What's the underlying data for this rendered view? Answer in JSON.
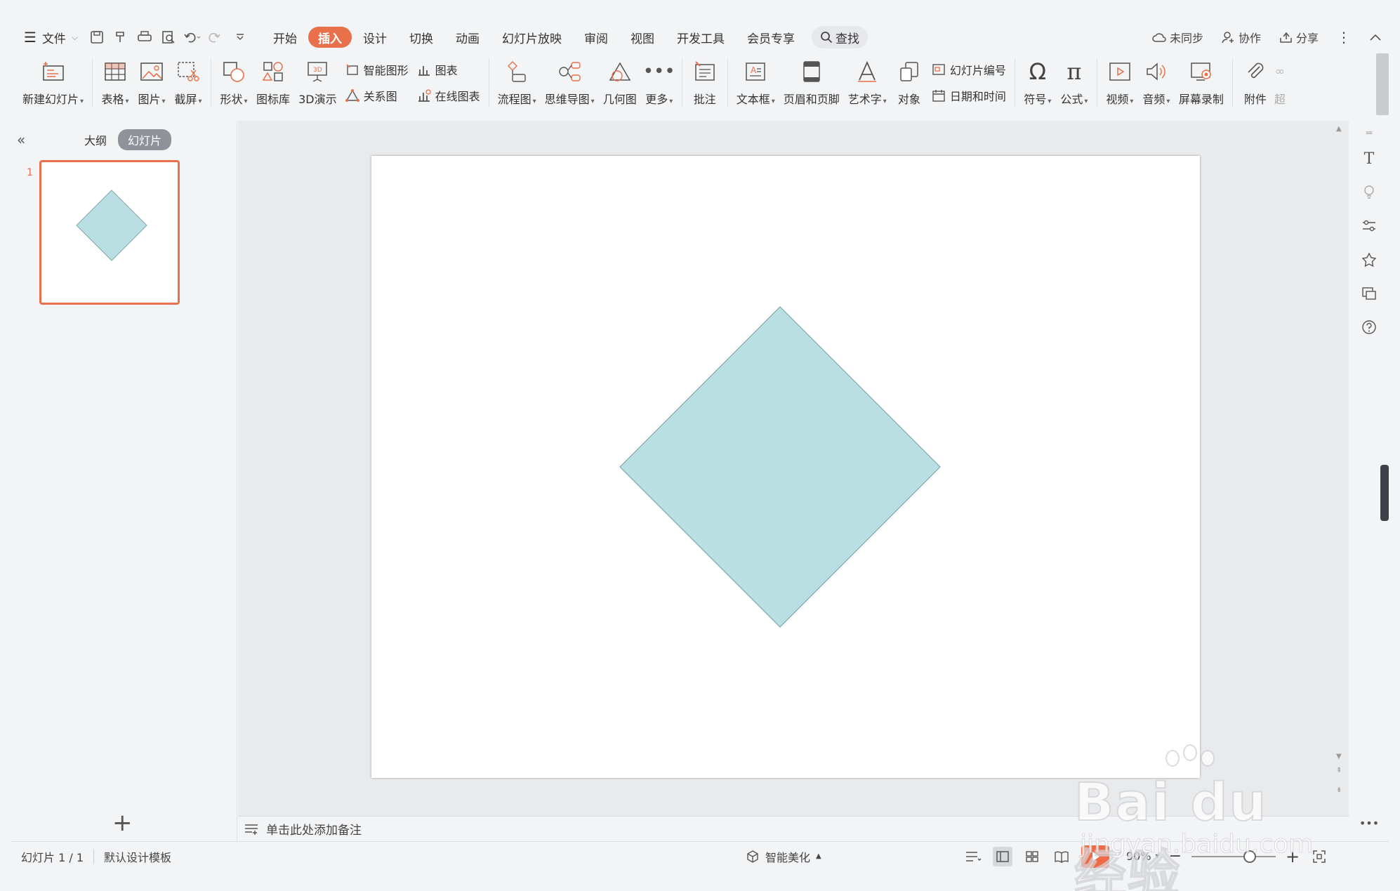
{
  "menubar": {
    "file_label": "文件",
    "tabs": [
      "开始",
      "插入",
      "设计",
      "切换",
      "动画",
      "幻灯片放映",
      "审阅",
      "视图",
      "开发工具",
      "会员专享"
    ],
    "active_tab_index": 1,
    "search_label": "查找",
    "sync_label": "未同步",
    "collab_label": "协作",
    "share_label": "分享"
  },
  "ribbon": {
    "new_slide": "新建幻灯片",
    "table": "表格",
    "picture": "图片",
    "screenshot": "截屏",
    "shape": "形状",
    "icon_lib": "图标库",
    "demo3d": "3D演示",
    "smart_graphic": "智能图形",
    "chart": "图表",
    "relation": "关系图",
    "online_chart": "在线图表",
    "flowchart": "流程图",
    "mindmap": "思维导图",
    "geometry": "几何图",
    "more": "更多",
    "comment": "批注",
    "textbox": "文本框",
    "header_footer": "页眉和页脚",
    "wordart": "艺术字",
    "object": "对象",
    "slide_number": "幻灯片编号",
    "datetime": "日期和时间",
    "symbol": "符号",
    "formula": "公式",
    "video": "视频",
    "audio": "音频",
    "screen_record": "屏幕录制",
    "attachment": "附件",
    "hyperlink": "超"
  },
  "leftpanel": {
    "outline_tab": "大纲",
    "slides_tab": "幻灯片",
    "slide_number": "1"
  },
  "slide": {
    "shape": "diamond",
    "fill_color": "#badfe2",
    "stroke_color": "#7ea7ab"
  },
  "notes": {
    "placeholder": "单击此处添加备注"
  },
  "status": {
    "slide_counter": "幻灯片 1 / 1",
    "template": "默认设计模板",
    "beautify": "智能美化",
    "zoom": "90%"
  },
  "colors": {
    "accent": "#e8704a"
  },
  "watermark": {
    "brand": "Bai du 经验",
    "url": "jingyan.baidu.com"
  }
}
